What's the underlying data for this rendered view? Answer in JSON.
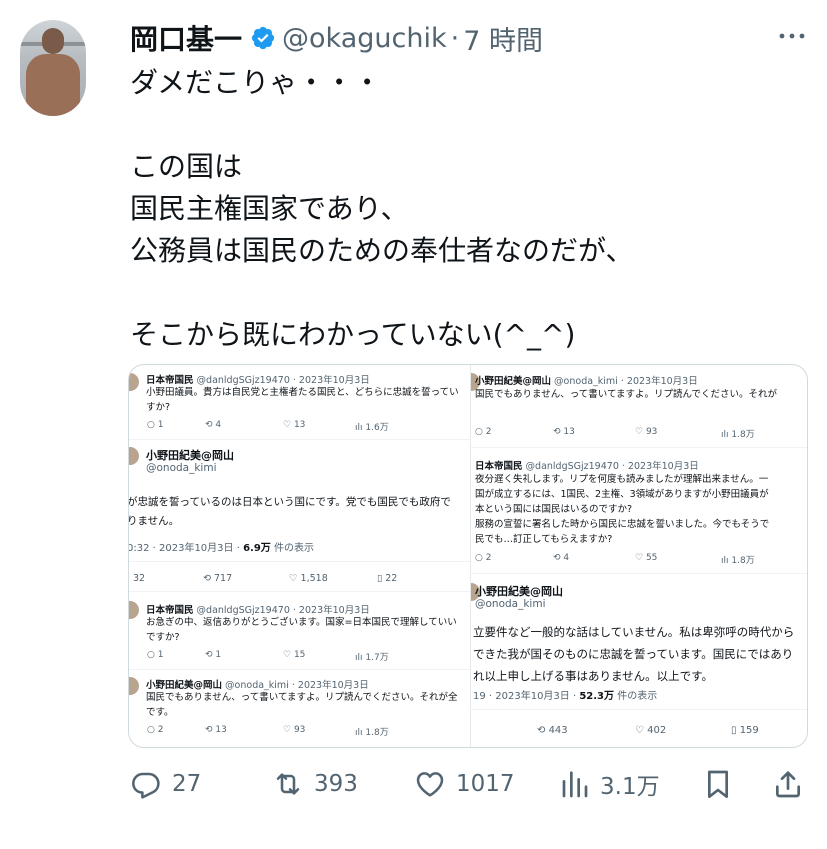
{
  "tweet": {
    "author_name": "岡口基一",
    "author_handle": "@okaguchik",
    "separator": "·",
    "time": "7 時間",
    "text": "ダメだこりゃ・・・\n\nこの国は\n国民主権国家であり、\n公務員は国民のための奉仕者なのだが、\n\nそこから既にわかっていない(^_^)"
  },
  "media": {
    "left": [
      {
        "name": "日本帝国民",
        "handle": "@danldgSGjz19470",
        "date": "· 2023年10月3日",
        "lines": [
          "小野田議員。貴方は自民党と主権者たる国民と、どちらに忠誠を誓ってい",
          "すか?"
        ],
        "stats": [
          "1",
          "4",
          "13",
          "1.6万"
        ]
      },
      {
        "name": "小野田紀美@岡山",
        "handle": "@onoda_kimi",
        "lines": [
          "が忠誠を誓っているのは日本という国にです。党でも国民でも政府で",
          "りません。"
        ],
        "meta_time": "0:32 · 2023年10月3日 · ",
        "meta_views": "6.9万",
        "meta_suffix": " 件の表示",
        "stats": [
          "32",
          "717",
          "1,518",
          "22"
        ]
      },
      {
        "name": "日本帝国民",
        "handle": "@danldgSGjz19470",
        "date": "· 2023年10月3日",
        "lines": [
          "お急ぎの中、返信ありがとうございます。国家=日本国民で理解していい",
          "ですか?"
        ],
        "stats": [
          "1",
          "1",
          "15",
          "1.7万"
        ]
      },
      {
        "name": "小野田紀美@岡山",
        "handle": "@onoda_kimi",
        "date": "· 2023年10月3日",
        "lines": [
          "国民でもありません、って書いてますよ。リプ読んでください。それが全",
          "です。"
        ],
        "stats": [
          "2",
          "13",
          "93",
          "1.8万"
        ]
      }
    ],
    "right": [
      {
        "name": "小野田紀美@岡山",
        "handle": "@onoda_kimi",
        "date": "· 2023年10月3日",
        "lines": [
          "国民でもありません、って書いてますよ。リプ読んでください。それが"
        ],
        "stats": [
          "2",
          "13",
          "93",
          "1.8万"
        ]
      },
      {
        "name": "日本帝国民",
        "handle": "@danldgSGjz19470",
        "date": "· 2023年10月3日",
        "lines": [
          "夜分遅く失礼します。リプを何度も読みましたが理解出来ません。一",
          "国が成立するには、1国民、2主権、3領域がありますが小野田議員が",
          "本という国には国民はいるのですか?",
          "服務の宣誓に署名した時から国民に忠誠を誓いました。今でもそうで",
          "民でも…訂正してもらえますか?"
        ],
        "stats": [
          "2",
          "4",
          "55",
          "1.8万"
        ]
      },
      {
        "name": "小野田紀美@岡山",
        "handle": "@onoda_kimi",
        "lines": [
          "立要件など一般的な話はしていません。私は卑弥呼の時代から",
          "できた我が国そのものに忠誠を誓っています。国民にではあり",
          "れ以上申し上げる事はありません。以上です。"
        ],
        "meta_time": "19 · 2023年10月3日 · ",
        "meta_views": "52.3万",
        "meta_suffix": " 件の表示",
        "stats": [
          "443",
          "402",
          "159"
        ]
      }
    ]
  },
  "actions": {
    "reply_count": "27",
    "retweet_count": "393",
    "like_count": "1017",
    "views_count": "3.1万"
  },
  "icons": {
    "verified": "verified-badge-icon",
    "more": "more-icon",
    "reply": "reply-icon",
    "retweet": "retweet-icon",
    "like": "like-icon",
    "views": "views-icon",
    "bookmark": "bookmark-icon",
    "share": "share-icon"
  },
  "colors": {
    "verified": "#1d9bf0",
    "secondary_text": "#536471",
    "primary_text": "#0f1419",
    "border": "#cfd9de"
  }
}
